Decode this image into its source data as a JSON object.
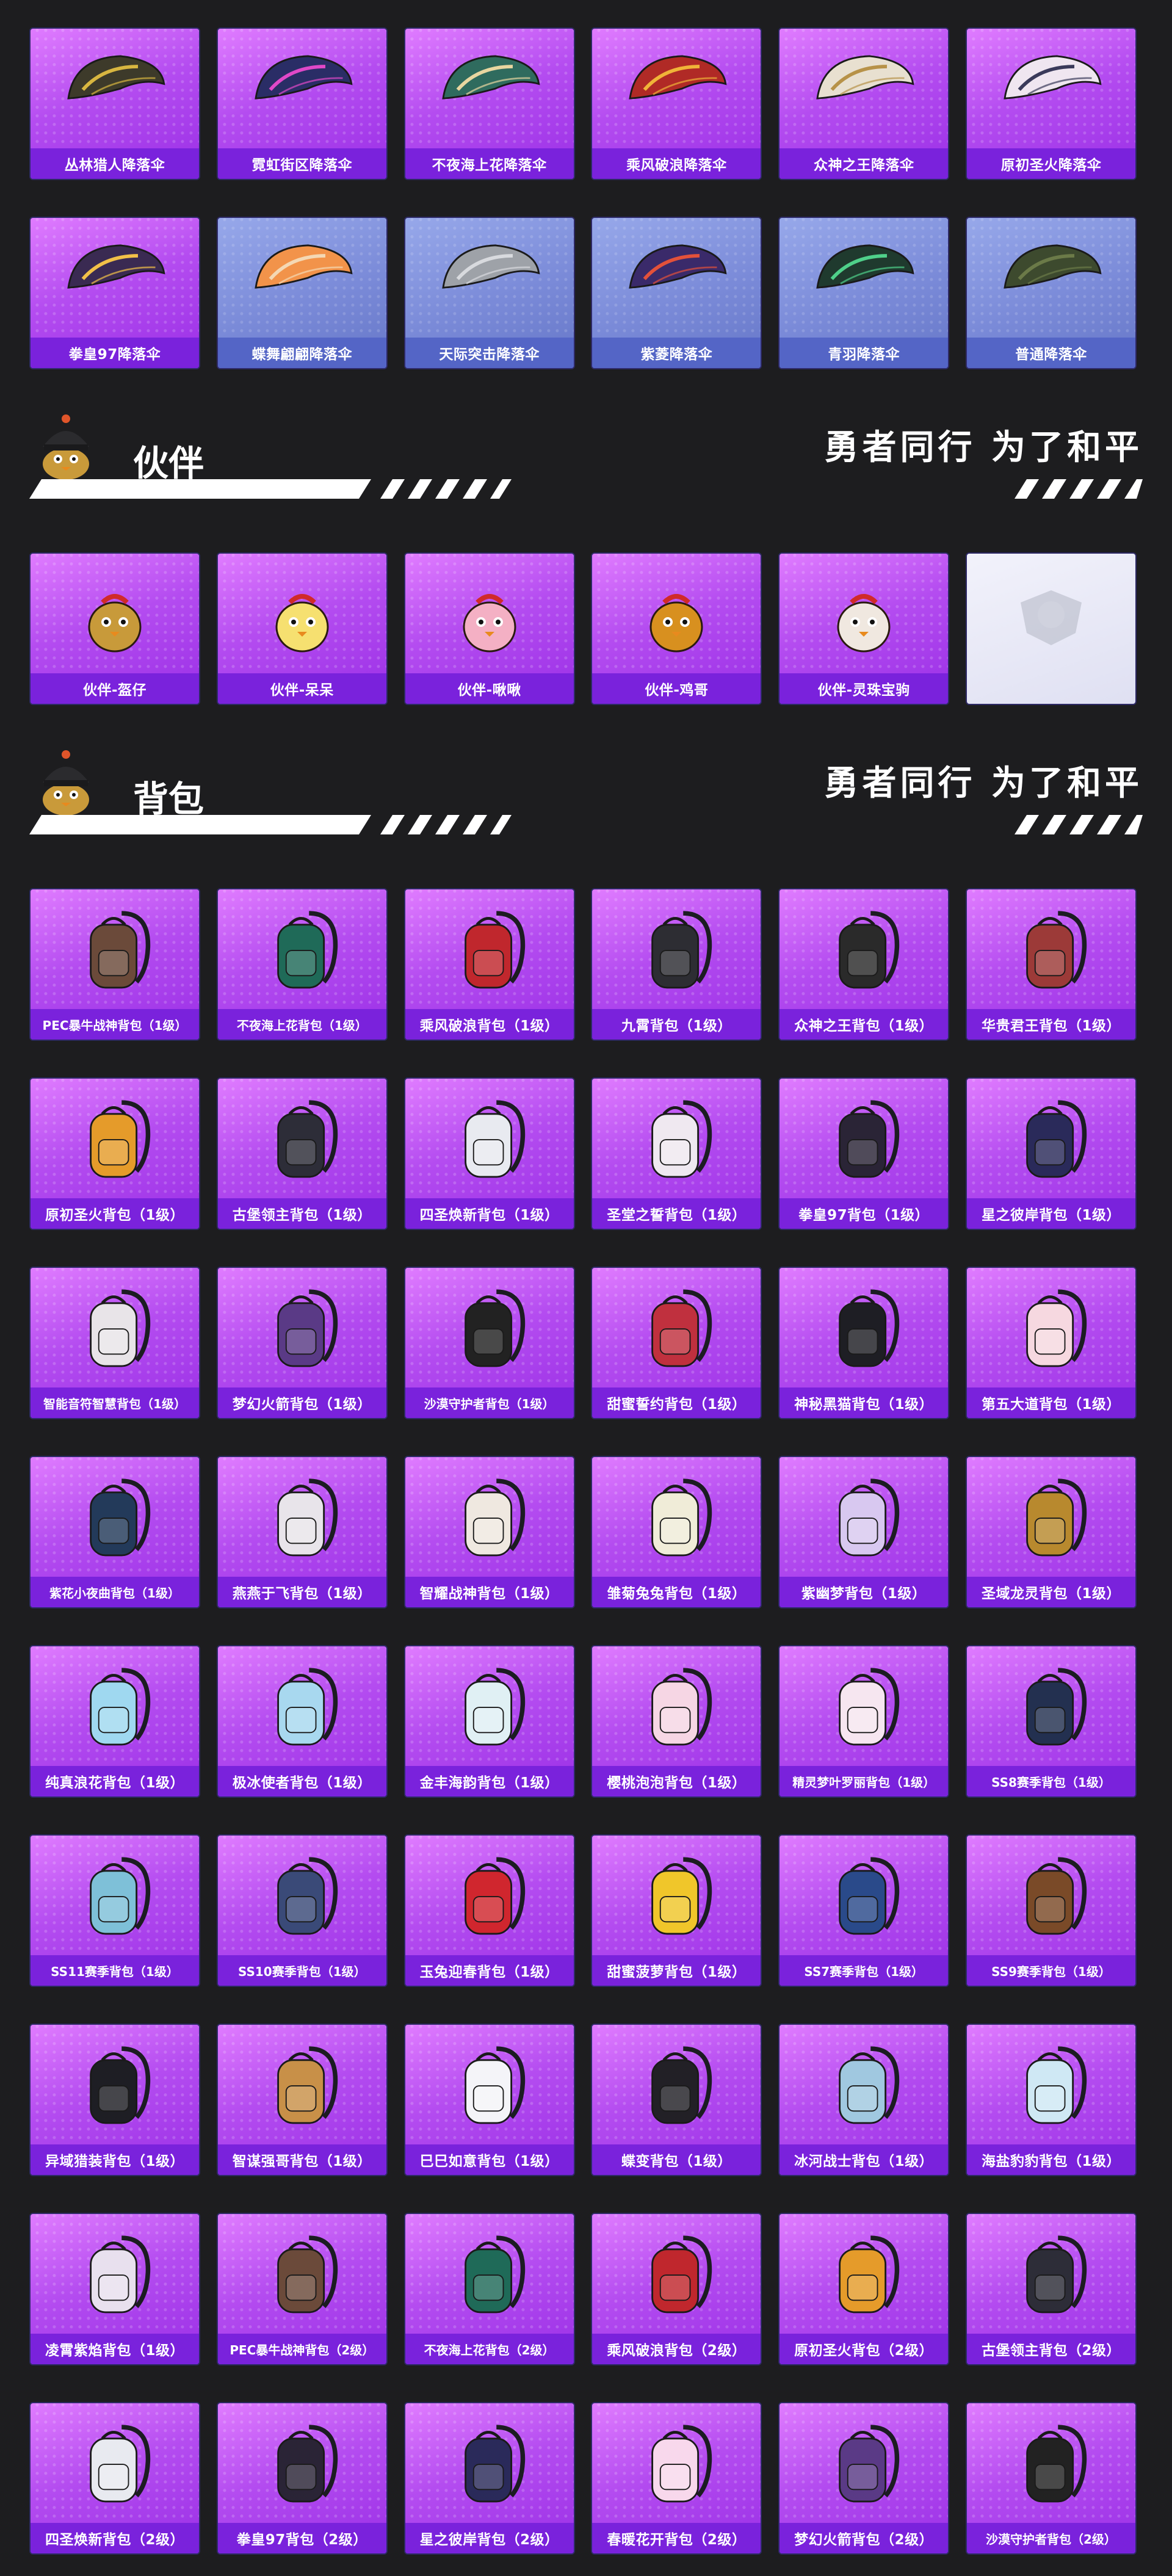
{
  "parachutes_row1": [
    {
      "label": "丛林猎人降落伞",
      "color": "#3d3a2a",
      "accent": "#d8b640"
    },
    {
      "label": "霓虹街区降落伞",
      "color": "#2a2d66",
      "accent": "#e048c8"
    },
    {
      "label": "不夜海上花降落伞",
      "color": "#2f6b5e",
      "accent": "#e8d6a0"
    },
    {
      "label": "乘风破浪降落伞",
      "color": "#b02a26",
      "accent": "#f0b438"
    },
    {
      "label": "众神之王降落伞",
      "color": "#e8e0d0",
      "accent": "#b79248"
    },
    {
      "label": "原初圣火降落伞",
      "color": "#efe6f0",
      "accent": "#3a3a5a"
    }
  ],
  "parachutes_row2": [
    {
      "label": "拳皇97降落伞",
      "color": "#3a2a52",
      "accent": "#f2c048",
      "theme": "purple"
    },
    {
      "label": "蝶舞翩翩降落伞",
      "color": "#f2934a",
      "accent": "#f4d8b4",
      "theme": "blue"
    },
    {
      "label": "天际突击降落伞",
      "color": "#9ea2a8",
      "accent": "#d8dade",
      "theme": "blue"
    },
    {
      "label": "紫菱降落伞",
      "color": "#3a2a6a",
      "accent": "#e3513a",
      "theme": "blue"
    },
    {
      "label": "青羽降落伞",
      "color": "#1f3a2e",
      "accent": "#4fd08a",
      "theme": "blue"
    },
    {
      "label": "普通降落伞",
      "color": "#3d4a2e",
      "accent": "#6b7a48",
      "theme": "blue"
    }
  ],
  "section_partner": {
    "title": "伙伴",
    "slogan": "勇者同行 为了和平"
  },
  "partners": [
    {
      "label": "伙伴-盔仔",
      "color": "#c89a3a",
      "theme": "purple"
    },
    {
      "label": "伙伴-呆呆",
      "color": "#f6e070",
      "theme": "purple"
    },
    {
      "label": "伙伴-啾啾",
      "color": "#f4b0c4",
      "theme": "purple"
    },
    {
      "label": "伙伴-鸡哥",
      "color": "#d8901f",
      "theme": "purple"
    },
    {
      "label": "伙伴-灵珠宝驹",
      "color": "#f0e8e0",
      "theme": "purple"
    },
    {
      "label": "",
      "color": "#b8bac8",
      "theme": "silver"
    }
  ],
  "section_backpack": {
    "title": "背包",
    "slogan": "勇者同行 为了和平"
  },
  "backpacks": [
    {
      "label": "PEC暴牛战神背包（1级）",
      "color": "#6b4a3a"
    },
    {
      "label": "不夜海上花背包（1级）",
      "color": "#1f6a58"
    },
    {
      "label": "乘风破浪背包（1级）",
      "color": "#c0272d"
    },
    {
      "label": "九霄背包（1级）",
      "color": "#2d2d33"
    },
    {
      "label": "众神之王背包（1级）",
      "color": "#2a2a2a"
    },
    {
      "label": "华贵君王背包（1级）",
      "color": "#9c3a38"
    },
    {
      "label": "原初圣火背包（1级）",
      "color": "#e59b2a"
    },
    {
      "label": "古堡领主背包（1级）",
      "color": "#2d2d38"
    },
    {
      "label": "四圣焕新背包（1级）",
      "color": "#e8eaf0"
    },
    {
      "label": "圣堂之誓背包（1级）",
      "color": "#efe8f0"
    },
    {
      "label": "拳皇97背包（1级）",
      "color": "#2a2436"
    },
    {
      "label": "星之彼岸背包（1级）",
      "color": "#2a2a5a"
    },
    {
      "label": "智能音符智慧背包（1级）",
      "color": "#e8e4e8"
    },
    {
      "label": "梦幻火箭背包（1级）",
      "color": "#5a3a86"
    },
    {
      "label": "沙漠守护者背包（1级）",
      "color": "#222222"
    },
    {
      "label": "甜蜜誓约背包（1级）",
      "color": "#c0303e"
    },
    {
      "label": "神秘黑猫背包（1级）",
      "color": "#1e1e24"
    },
    {
      "label": "第五大道背包（1级）",
      "color": "#f6d8e0"
    },
    {
      "label": "紫花小夜曲背包（1级）",
      "color": "#233a5a"
    },
    {
      "label": "燕燕于飞背包（1级）",
      "color": "#e8e4ea"
    },
    {
      "label": "智耀战神背包（1级）",
      "color": "#efe8e0"
    },
    {
      "label": "雏菊兔兔背包（1级）",
      "color": "#f0ecd8"
    },
    {
      "label": "紫幽梦背包（1级）",
      "color": "#d8c8f0"
    },
    {
      "label": "圣域龙灵背包（1级）",
      "color": "#b8892e"
    },
    {
      "label": "纯真浪花背包（1级）",
      "color": "#9fd8f0"
    },
    {
      "label": "极冰使者背包（1级）",
      "color": "#a8d8ef"
    },
    {
      "label": "金丰海韵背包（1级）",
      "color": "#e0f0f4"
    },
    {
      "label": "樱桃泡泡背包（1级）",
      "color": "#f6d6e4"
    },
    {
      "label": "精灵梦叶罗丽背包（1级）",
      "color": "#f6e6f0"
    },
    {
      "label": "SS8赛季背包（1级）",
      "color": "#233050"
    },
    {
      "label": "SS11赛季背包（1级）",
      "color": "#7ec0d8"
    },
    {
      "label": "SS10赛季背包（1级）",
      "color": "#3a4a78"
    },
    {
      "label": "玉兔迎春背包（1级）",
      "color": "#d0262e"
    },
    {
      "label": "甜蜜菠萝背包（1级）",
      "color": "#f0c62a"
    },
    {
      "label": "SS7赛季背包（1级）",
      "color": "#2a4a8a"
    },
    {
      "label": "SS9赛季背包（1级）",
      "color": "#7a4a28"
    },
    {
      "label": "异域猎装背包（1级）",
      "color": "#1e1e24"
    },
    {
      "label": "智谋强哥背包（1级）",
      "color": "#c89048"
    },
    {
      "label": "巳巳如意背包（1级）",
      "color": "#f4f4f8"
    },
    {
      "label": "蝶变背包（1级）",
      "color": "#222026"
    },
    {
      "label": "冰河战士背包（1级）",
      "color": "#a0c8e0"
    },
    {
      "label": "海盐豹豹背包（1级）",
      "color": "#cfe8f4"
    },
    {
      "label": "凌霄紫焰背包（1级）",
      "color": "#e8e0ee"
    },
    {
      "label": "PEC暴牛战神背包（2级）",
      "color": "#6b4a3a"
    },
    {
      "label": "不夜海上花背包（2级）",
      "color": "#1f6a58"
    },
    {
      "label": "乘风破浪背包（2级）",
      "color": "#c0272d"
    },
    {
      "label": "原初圣火背包（2级）",
      "color": "#e59b2a"
    },
    {
      "label": "古堡领主背包（2级）",
      "color": "#2d2d38"
    },
    {
      "label": "四圣焕新背包（2级）",
      "color": "#e8eaf0"
    },
    {
      "label": "拳皇97背包（2级）",
      "color": "#2a2436"
    },
    {
      "label": "星之彼岸背包（2级）",
      "color": "#2a2a5a"
    },
    {
      "label": "春暖花开背包（2级）",
      "color": "#f8d8ec"
    },
    {
      "label": "梦幻火箭背包（2级）",
      "color": "#5a3a86"
    },
    {
      "label": "沙漠守护者背包（2级）",
      "color": "#222222"
    }
  ]
}
